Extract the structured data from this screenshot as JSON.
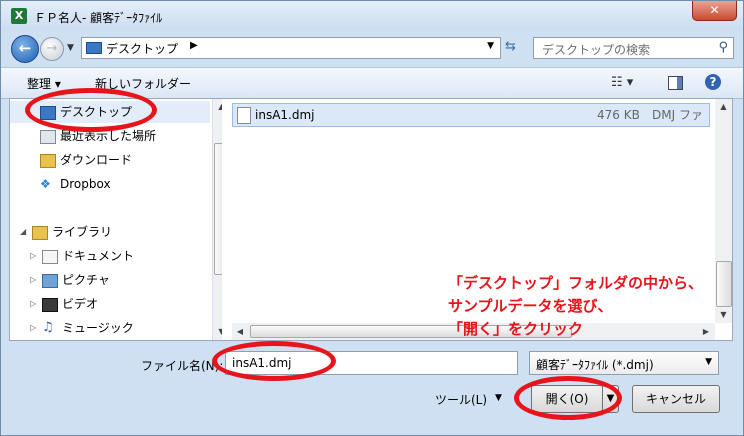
{
  "window": {
    "app_icon": "X",
    "title": "ＦＰ名人- 顧客ﾃﾞｰﾀﾌｧｲﾙ",
    "close_label": "✕"
  },
  "navbar": {
    "address": "デスクトップ",
    "search_placeholder": "デスクトップの検索"
  },
  "toolbar": {
    "organize": "整理 ▾",
    "new_folder": "新しいフォルダー"
  },
  "nav_pane": {
    "items": [
      {
        "label": "デスクトップ",
        "icon": "desktop-icon"
      },
      {
        "label": "最近表示した場所",
        "icon": "recent-places-icon"
      },
      {
        "label": "ダウンロード",
        "icon": "downloads-icon"
      },
      {
        "label": "Dropbox",
        "icon": "dropbox-icon"
      },
      {
        "label": "ライブラリ",
        "icon": "library-icon"
      },
      {
        "label": "ドキュメント",
        "icon": "documents-icon"
      },
      {
        "label": "ピクチャ",
        "icon": "pictures-icon"
      },
      {
        "label": "ビデオ",
        "icon": "videos-icon"
      },
      {
        "label": "ミュージック",
        "icon": "music-icon"
      }
    ]
  },
  "files": [
    {
      "name": "insA1.dmj",
      "size": "476 KB",
      "type": "DMJ ファ"
    }
  ],
  "footer": {
    "filename_label": "ファイル名(N):",
    "filename_value": "insA1.dmj",
    "filetype_value": "顧客ﾃﾞｰﾀﾌｧｲﾙ (*.dmj)",
    "tools_label": "ツール(L)",
    "open_label": "開く(O)",
    "cancel_label": "キャンセル"
  },
  "annotation": {
    "line1": "「デスクトップ」フォルダの中から、",
    "line2": "サンプルデータを選び、",
    "line3": "「開く」をクリック"
  },
  "colors": {
    "annotation_red": "#e8141b",
    "selection": "#dbe8f8",
    "title_close": "#c74a30"
  }
}
